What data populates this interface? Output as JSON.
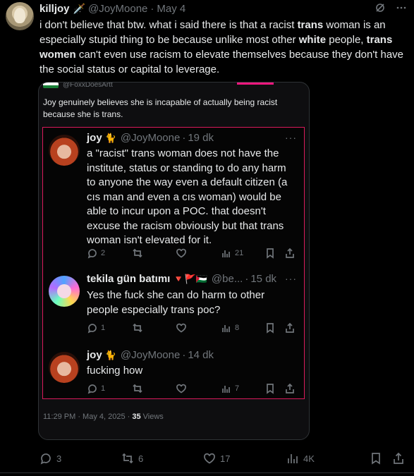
{
  "post": {
    "author_name": "killjoy",
    "author_badge": "🗡️",
    "handle": "@JoyMoone",
    "separator": "·",
    "time": "May 4",
    "text_parts": [
      {
        "t": "i don't believe that btw. what i said there is that a racist ",
        "b": false
      },
      {
        "t": "trans",
        "b": true
      },
      {
        "t": " woman is an especially stupid thing to be because unlike most other ",
        "b": false
      },
      {
        "t": "white",
        "b": true
      },
      {
        "t": " people, ",
        "b": false
      },
      {
        "t": "trans women",
        "b": true
      },
      {
        "t": " can't even use racism to elevate themselves because they don't have the social status or capital to leverage.",
        "b": false
      }
    ],
    "stats": {
      "replies": "3",
      "reposts": "6",
      "likes": "17",
      "views": "4K"
    }
  },
  "quote": {
    "top_handle": "@FoxxDoesArtt",
    "caption": "Joy genuinely believes she is incapable of actually being racist because she is trans.",
    "timestamp": "11:29 PM · May 4, 2025 · ",
    "views_count": "35",
    "views_label": " Views",
    "replies": [
      {
        "name": "joy",
        "emoji": "🐈",
        "handle": "@JoyMoone",
        "dot": "·",
        "time": "19 dk",
        "text": "a \"racist\" trans woman does not have the institute, status or standing to do any harm to anyone the way even a default citizen (a cıs man and even a cıs woman) would be able to incur upon a POC. that doesn't excuse the racism obviously but that trans woman isn't elevated for it.",
        "replies": "2",
        "reposts": "",
        "likes": "",
        "views": "21"
      },
      {
        "name": "tekila gün batımı",
        "emoji": "🔻🚩🇵🇸",
        "handle": "@be...",
        "dot": "·",
        "time": "15 dk",
        "text": "Yes the fuck she can do harm to other people especially trans poc?",
        "replies": "1",
        "reposts": "",
        "likes": "",
        "views": "8"
      },
      {
        "name": "joy",
        "emoji": "🐈",
        "handle": "@JoyMoone",
        "dot": "·",
        "time": "14 dk",
        "text": "fucking how",
        "replies": "1",
        "reposts": "",
        "likes": "",
        "views": "7"
      }
    ]
  },
  "colors": {
    "accent_border": "#d91a5b",
    "muted": "#71767b",
    "text": "#e7e9ea"
  }
}
